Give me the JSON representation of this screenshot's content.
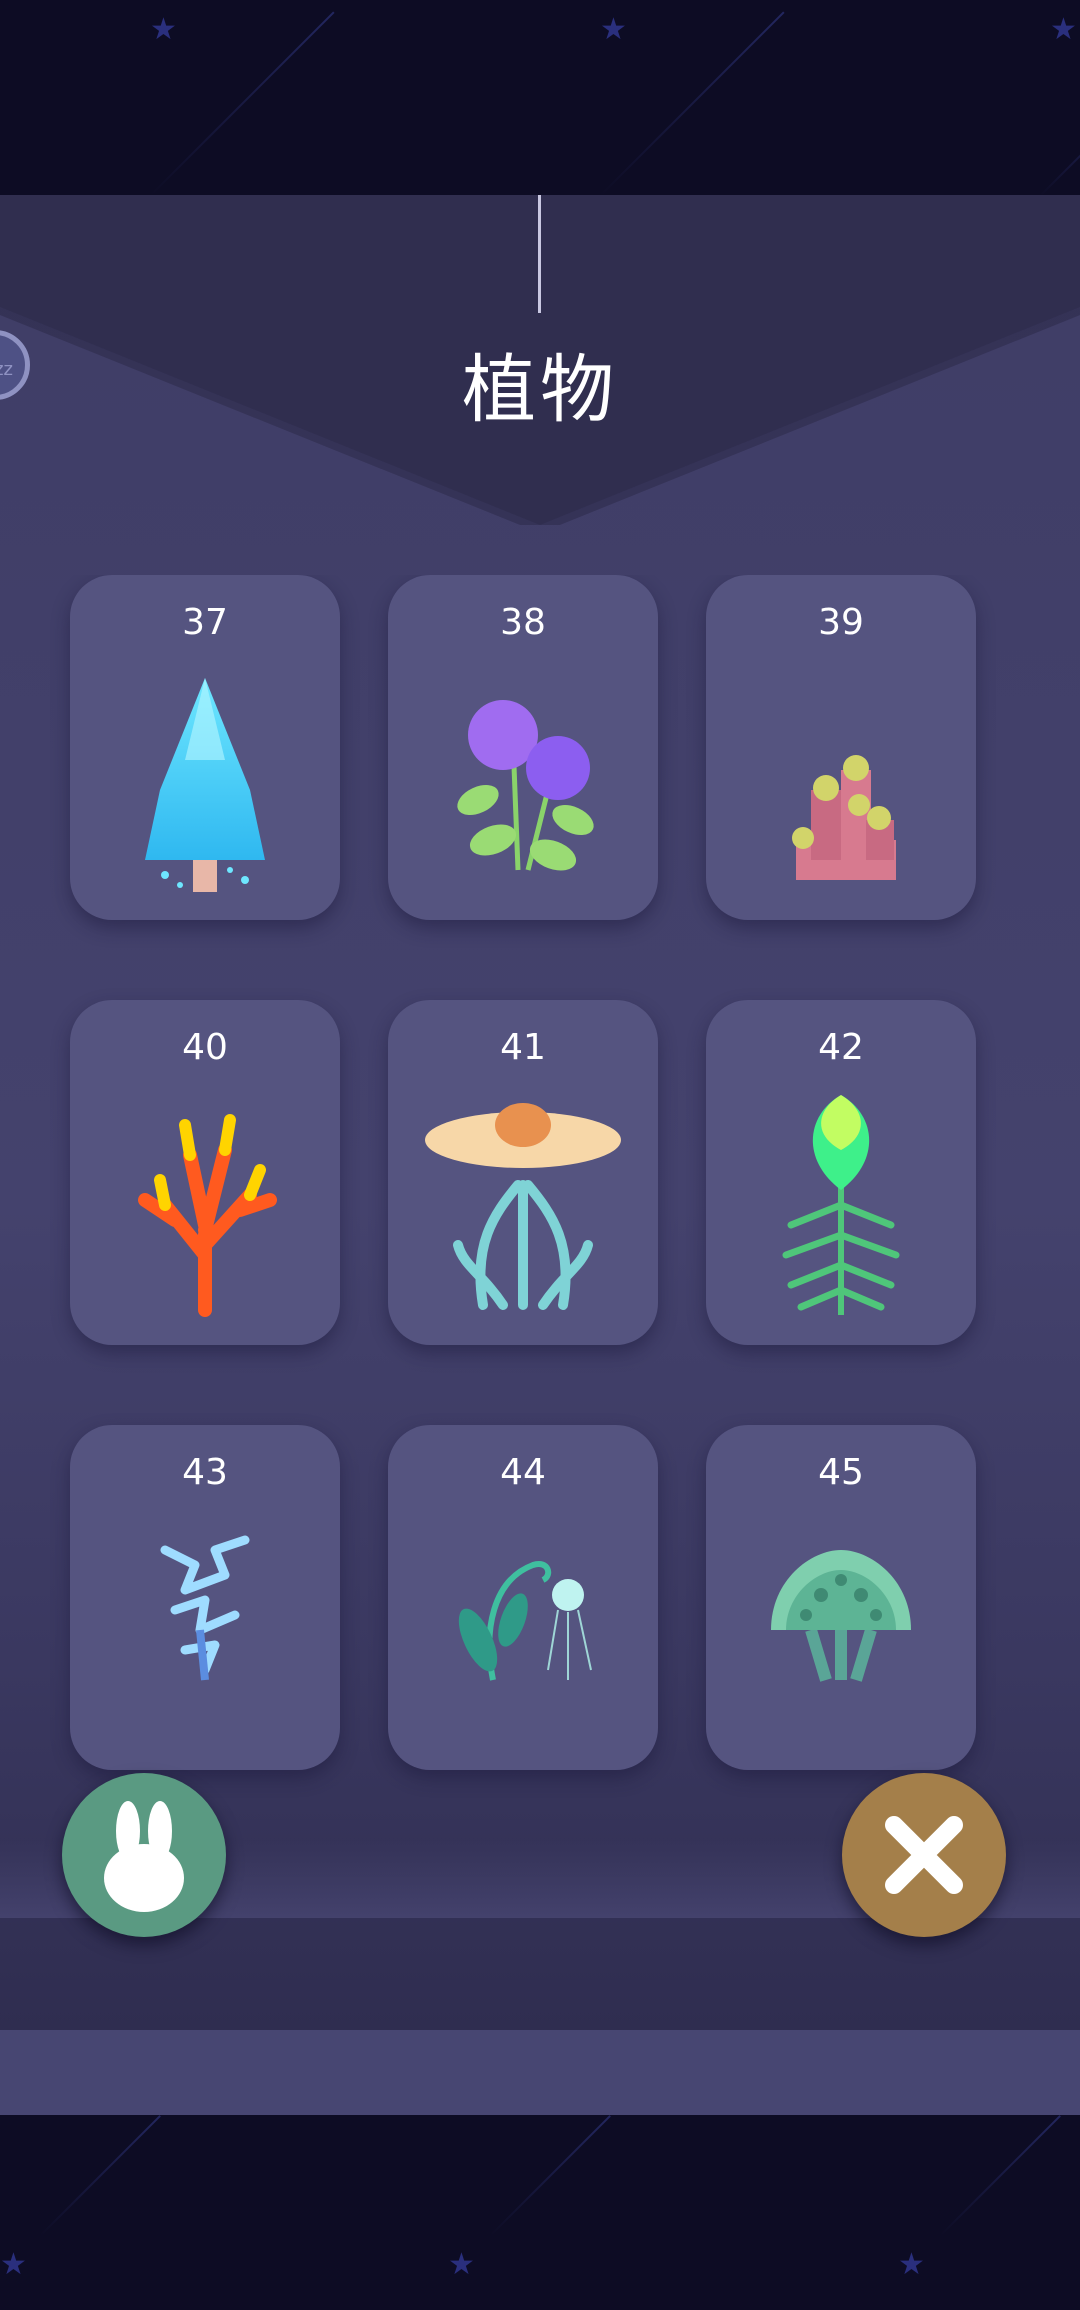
{
  "header": {
    "title": "植物"
  },
  "cards": [
    {
      "number": "37",
      "plant_icon": "water-drop-tree-icon"
    },
    {
      "number": "38",
      "plant_icon": "hydrangea-icon"
    },
    {
      "number": "39",
      "plant_icon": "pink-cactus-icon"
    },
    {
      "number": "40",
      "plant_icon": "fire-coral-icon"
    },
    {
      "number": "41",
      "plant_icon": "rafflesia-icon"
    },
    {
      "number": "42",
      "plant_icon": "glowing-bud-icon"
    },
    {
      "number": "43",
      "plant_icon": "ice-crystal-plant-icon"
    },
    {
      "number": "44",
      "plant_icon": "jellyfish-vine-icon"
    },
    {
      "number": "45",
      "plant_icon": "mushroom-tree-icon"
    }
  ],
  "actions": {
    "left": "rabbit-icon",
    "right": "close-icon"
  },
  "colors": {
    "night_sky": "#0d0c24",
    "panel": "#44426d",
    "card": "#555480",
    "rabbit_button": "#5a9a82",
    "close_button": "#a47f4a"
  }
}
